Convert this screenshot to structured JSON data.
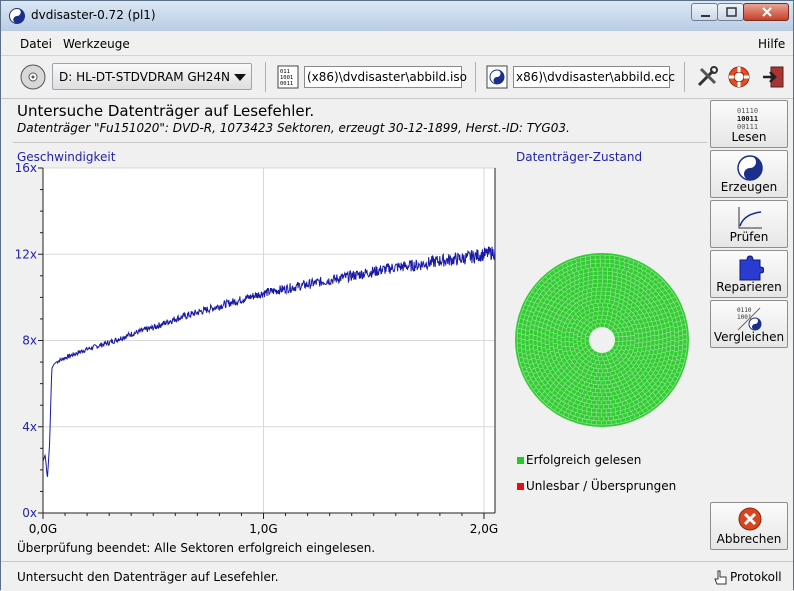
{
  "window": {
    "title": "dvdisaster-0.72 (pl1)"
  },
  "menu": {
    "datei": "Datei",
    "werkzeuge": "Werkzeuge",
    "hilfe": "Hilfe"
  },
  "toolbar": {
    "drive": "D: HL-DT-STDVDRAM GH24N",
    "image_path": "(x86)\\dvdisaster\\abbild.iso",
    "ecc_path": "x86)\\dvdisaster\\abbild.ecc"
  },
  "main": {
    "heading": "Untersuche Datenträger auf Lesefehler.",
    "subheading": "Datenträger \"Fu151020\": DVD-R, 1073423 Sektoren, erzeugt 30-12-1899, Herst.-ID: TYG03.",
    "speed_label": "Geschwindigkeit",
    "state_label": "Datenträger-Zustand",
    "status_line": "Überprüfung beendet: Alle Sektoren erfolgreich eingelesen."
  },
  "legend": [
    {
      "label": "Erfolgreich gelesen",
      "color": "#22cc22"
    },
    {
      "label": "Unlesbar / Übersprungen",
      "color": "#dd1111"
    }
  ],
  "sidebar": {
    "lesen": "Lesen",
    "erzeugen": "Erzeugen",
    "pruefen": "Prüfen",
    "reparieren": "Reparieren",
    "vergleichen": "Vergleichen",
    "abbrechen": "Abbrechen"
  },
  "statusbar": {
    "text": "Untersucht den Datenträger auf Lesefehler.",
    "protokoll": "Protokoll"
  },
  "colors": {
    "line": "#1a1aa6",
    "axis_text": "#2222aa",
    "disc_green": "#33cc33"
  },
  "chart_data": {
    "type": "line",
    "title": "Geschwindigkeit",
    "xlabel": "",
    "ylabel": "",
    "xlim": [
      0,
      2.05
    ],
    "ylim": [
      0,
      16
    ],
    "x_ticks": [
      0,
      1,
      2
    ],
    "x_tick_labels": [
      "0,0G",
      "1,0G",
      "2,0G"
    ],
    "y_ticks": [
      0,
      4,
      8,
      12,
      16
    ],
    "y_tick_labels": [
      "0x",
      "4x",
      "8x",
      "12x",
      "16x"
    ],
    "grid": true,
    "series": [
      {
        "values_x": [
          0,
          0.01,
          0.02,
          0.03,
          0.04,
          0.05,
          0.06,
          0.08,
          0.1,
          0.15,
          0.2,
          0.3,
          0.4,
          0.5,
          0.6,
          0.7,
          0.8,
          0.9,
          1.0,
          1.1,
          1.2,
          1.3,
          1.4,
          1.5,
          1.6,
          1.7,
          1.8,
          1.9,
          2.0,
          2.05
        ],
        "values_y": [
          2.4,
          2.7,
          1.6,
          3.2,
          6.7,
          6.9,
          7.0,
          7.1,
          7.2,
          7.4,
          7.6,
          7.9,
          8.3,
          8.6,
          9.0,
          9.3,
          9.6,
          9.9,
          10.2,
          10.4,
          10.6,
          10.8,
          11.0,
          11.2,
          11.4,
          11.5,
          11.7,
          11.8,
          12.0,
          12.1
        ]
      }
    ]
  }
}
